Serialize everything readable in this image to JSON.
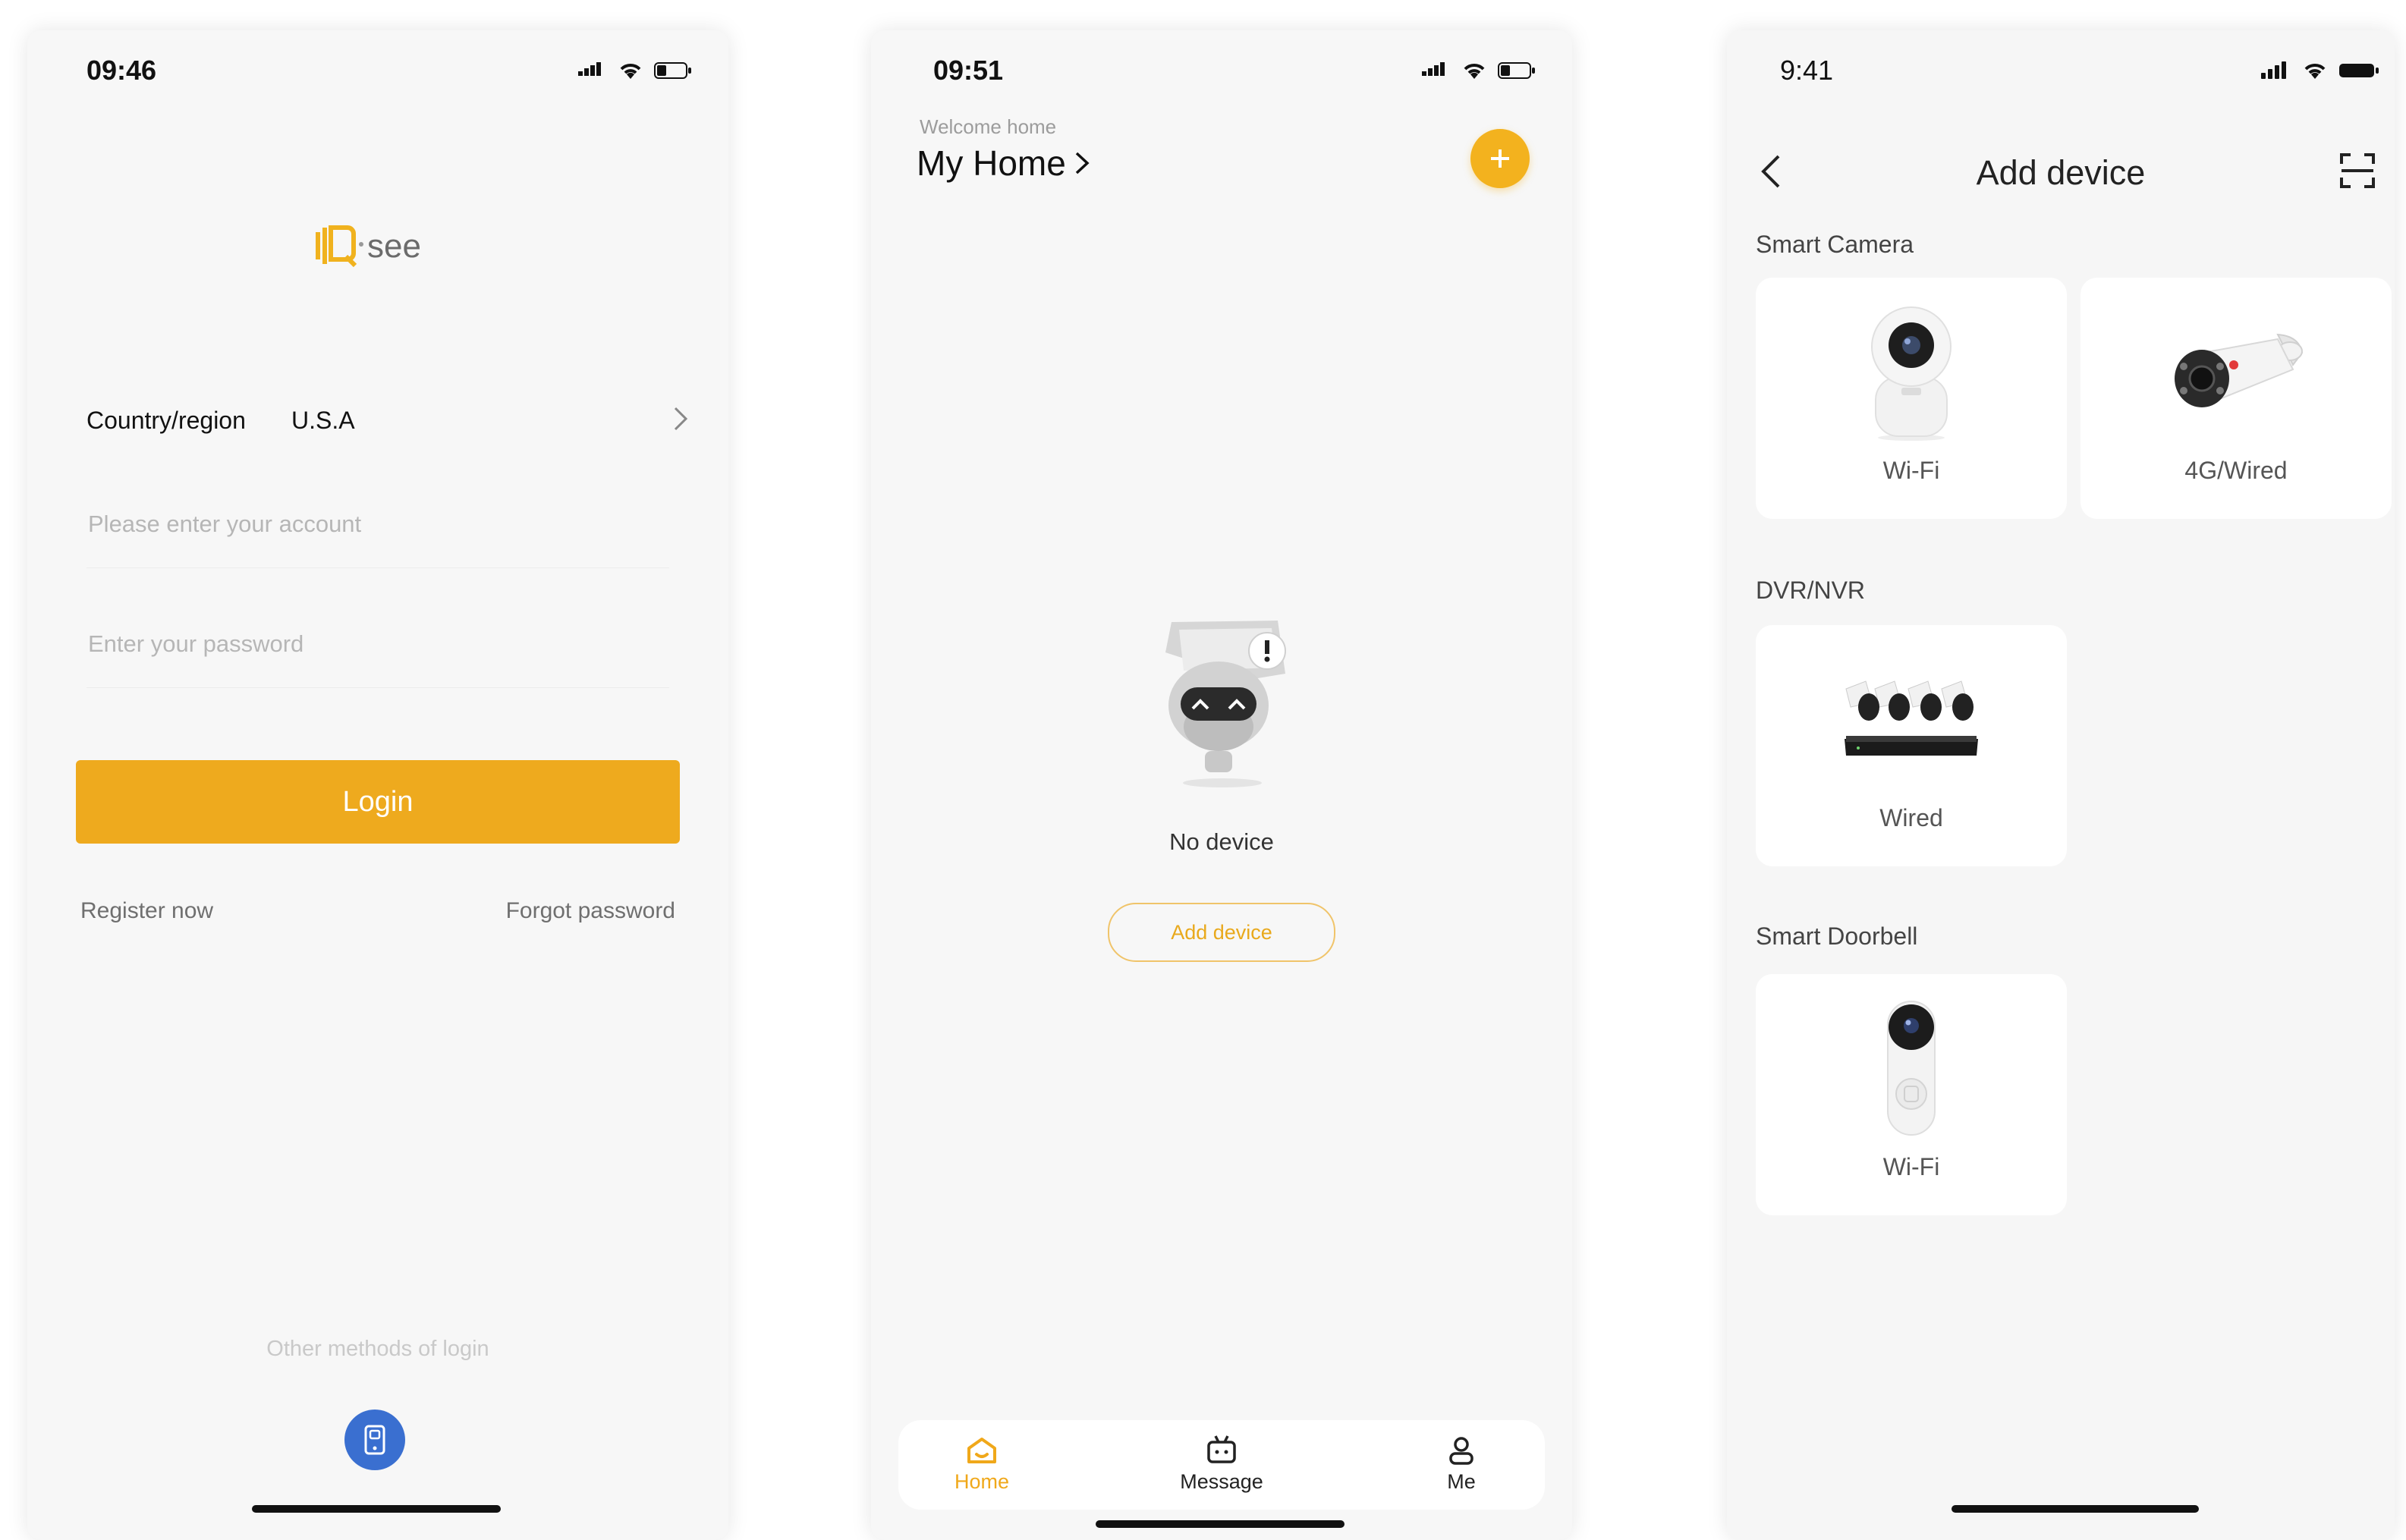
{
  "colors": {
    "accent": "#eeaa1e",
    "active_tab": "#f0a81a",
    "alt_login_blue": "#3a6fd0"
  },
  "screen1": {
    "status_time": "09:46",
    "logo_text": "see",
    "country_label": "Country/region",
    "country_value": "U.S.A",
    "account_placeholder": "Please enter your account",
    "password_placeholder": "Enter your password",
    "login_label": "Login",
    "register_label": "Register now",
    "forgot_label": "Forgot password",
    "other_methods_label": "Other methods of login"
  },
  "screen2": {
    "status_time": "09:51",
    "welcome_text": "Welcome home",
    "home_title": "My Home",
    "empty_text": "No device",
    "add_device_label": "Add device",
    "tabs": [
      {
        "label": "Home",
        "icon": "home-icon",
        "active": true
      },
      {
        "label": "Message",
        "icon": "message-icon",
        "active": false
      },
      {
        "label": "Me",
        "icon": "person-icon",
        "active": false
      }
    ]
  },
  "screen3": {
    "status_time": "9:41",
    "title": "Add device",
    "sections": [
      {
        "title": "Smart Camera",
        "cards": [
          {
            "label": "Wi-Fi",
            "icon": "indoor-camera-icon"
          },
          {
            "label": "4G/Wired",
            "icon": "bullet-camera-icon"
          }
        ]
      },
      {
        "title": "DVR/NVR",
        "cards": [
          {
            "label": "Wired",
            "icon": "dvr-kit-icon"
          }
        ]
      },
      {
        "title": "Smart Doorbell",
        "cards": [
          {
            "label": "Wi-Fi",
            "icon": "doorbell-icon"
          }
        ]
      }
    ]
  }
}
